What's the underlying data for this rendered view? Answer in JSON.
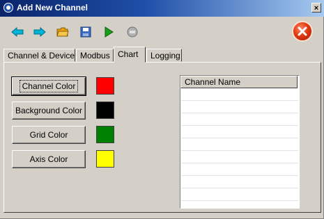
{
  "window": {
    "title": "Add New Channel",
    "close_glyph": "×"
  },
  "toolbar": {
    "icons": [
      {
        "name": "back-arrow-icon",
        "color": "#00b4d8"
      },
      {
        "name": "forward-arrow-icon",
        "color": "#00b4d8"
      },
      {
        "name": "open-folder-icon",
        "color": "#e8a317"
      },
      {
        "name": "save-disk-icon",
        "color": "#3a6fc4"
      },
      {
        "name": "play-icon",
        "color": "#1a9e1a"
      },
      {
        "name": "stop-icon",
        "color": "#9a9a9a"
      }
    ],
    "exit_icon": "close-circle-icon"
  },
  "tabs": [
    {
      "label": "Channel & Device",
      "active": false
    },
    {
      "label": "Modbus",
      "active": false
    },
    {
      "label": "Chart",
      "active": true
    },
    {
      "label": "Logging",
      "active": false
    }
  ],
  "chart_tab": {
    "buttons": [
      {
        "label": "Channel Color",
        "color": "#ff0000"
      },
      {
        "label": "Background Color",
        "color": "#000000"
      },
      {
        "label": "Grid Color",
        "color": "#008000"
      },
      {
        "label": "Axis Color",
        "color": "#ffff00"
      }
    ],
    "list": {
      "header": "Channel Name",
      "rows": []
    }
  }
}
